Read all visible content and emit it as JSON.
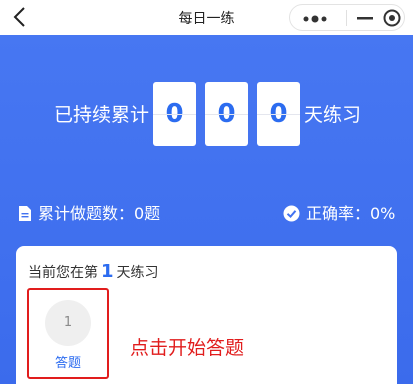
{
  "header": {
    "title": "每日一练"
  },
  "streak": {
    "prefix": "已持续累计",
    "digits": [
      "0",
      "0",
      "0"
    ],
    "suffix": "天练习"
  },
  "stats": {
    "total_label": "累计做题数：0题",
    "accuracy_label": "正确率：0%"
  },
  "card": {
    "day_prefix": "当前您在第",
    "day_number": "1",
    "day_suffix": "天练习",
    "task_number": "1",
    "task_label": "答题",
    "hint": "点击开始答题"
  },
  "colors": {
    "accent": "#2c6cf0",
    "hero_bg": "#4272f0",
    "highlight": "#e11d1d"
  }
}
